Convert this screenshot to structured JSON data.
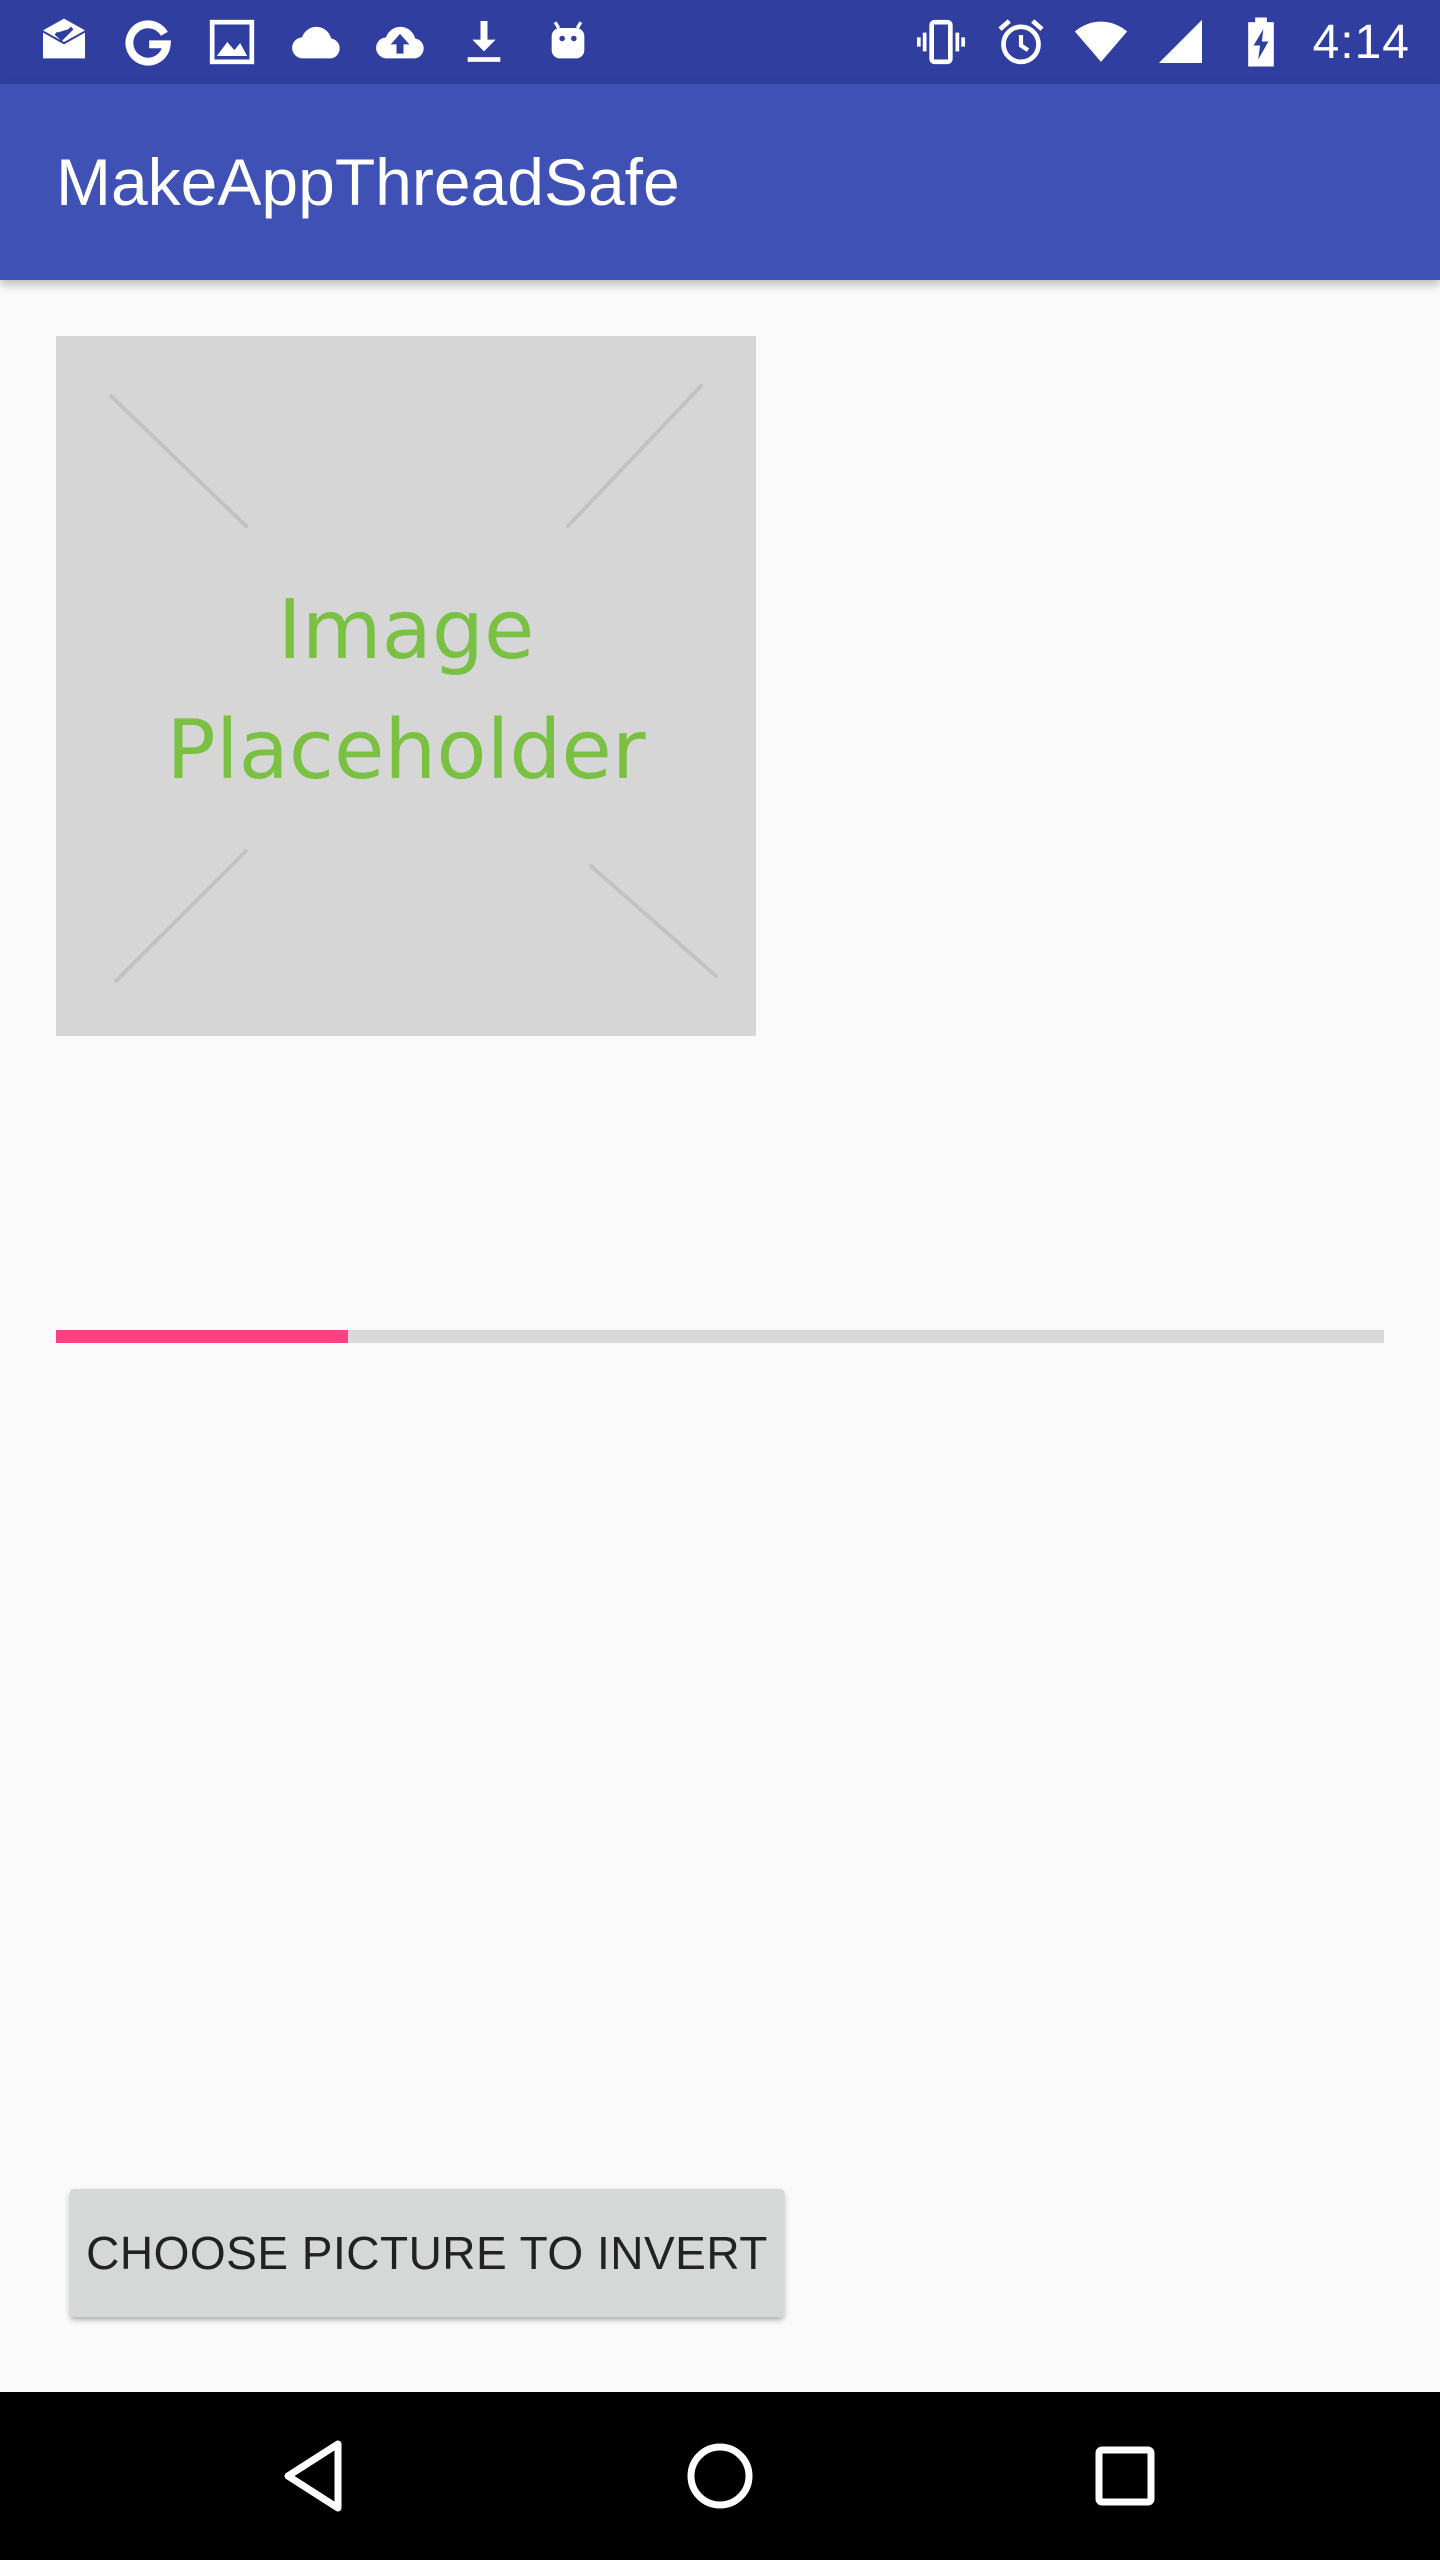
{
  "status_bar": {
    "time": "4:14",
    "left_icons": [
      "mail-icon",
      "google-icon",
      "image-icon",
      "cloud-icon",
      "cloud-upload-icon",
      "download-icon",
      "android-icon"
    ],
    "right_icons": [
      "vibrate-icon",
      "alarm-icon",
      "wifi-icon",
      "cellular-signal-icon",
      "battery-charging-icon"
    ]
  },
  "app_bar": {
    "title": "MakeAppThreadSafe"
  },
  "image_placeholder": {
    "line1": "Image",
    "line2": "Placeholder"
  },
  "progress": {
    "value": 0.22
  },
  "actions": {
    "choose_label": "CHOOSE PICTURE TO INVERT"
  },
  "nav_bar": {
    "buttons": [
      "back-icon",
      "home-icon",
      "recents-icon"
    ]
  },
  "colors": {
    "status_bar": "#303f9f",
    "app_bar": "#3f51b5",
    "accent": "#ff4081",
    "placeholder_bg": "#d6d6d6",
    "placeholder_text": "#7ac143",
    "background": "#fafafa"
  }
}
